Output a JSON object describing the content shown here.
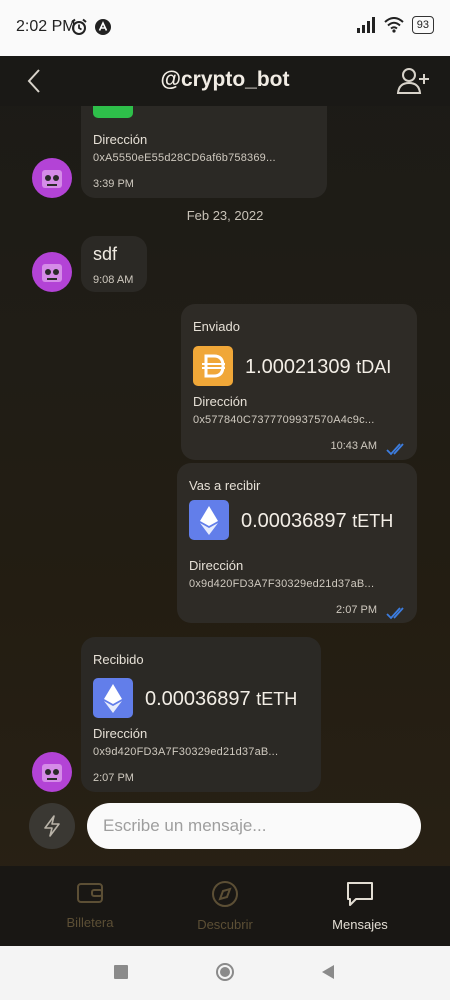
{
  "status_bar": {
    "time": "2:02 PM",
    "battery": "93",
    "icons": [
      "alarm-icon",
      "app-notification-icon",
      "signal-icon",
      "wifi-icon",
      "battery-icon"
    ]
  },
  "header": {
    "title": "@crypto_bot",
    "icons": [
      "back-arrow-icon",
      "add-user-icon"
    ]
  },
  "date_separator": "Feb 23, 2022",
  "messages": [
    {
      "side": "left",
      "type": "transaction",
      "address_label": "Dirección",
      "address": "0xA5550eE55d28CD6af6b758369...",
      "time": "3:39 PM"
    },
    {
      "side": "left",
      "type": "text",
      "text": "sdf",
      "time": "9:08 AM"
    },
    {
      "side": "right",
      "type": "transaction",
      "heading": "Enviado",
      "amount": "1.00021309",
      "token": "tDAI",
      "token_icon": "dai-icon",
      "address_label": "Dirección",
      "address": "0x577840C7377709937570A4c9c...",
      "time": "10:43 AM",
      "status_icon": "double-check-icon"
    },
    {
      "side": "right",
      "type": "transaction",
      "heading": "Vas a recibir",
      "amount": "0.00036897",
      "token": "tETH",
      "token_icon": "eth-icon",
      "address_label": "Dirección",
      "address": "0x9d420FD3A7F30329ed21d37aB...",
      "time": "2:07 PM",
      "status_icon": "double-check-icon"
    },
    {
      "side": "left",
      "type": "transaction",
      "heading": "Recibido",
      "amount": "0.00036897",
      "token": "tETH",
      "token_icon": "eth-icon",
      "address_label": "Dirección",
      "address": "0x9d420FD3A7F30329ed21d37aB...",
      "time": "2:07 PM"
    }
  ],
  "composer": {
    "placeholder": "Escribe un mensaje...",
    "value": "",
    "icon": "lightning-icon"
  },
  "bottom_nav": {
    "items": [
      {
        "label": "Billetera",
        "icon": "wallet-icon",
        "active": false
      },
      {
        "label": "Descubrir",
        "icon": "compass-icon",
        "active": false
      },
      {
        "label": "Mensajes",
        "icon": "chat-icon",
        "active": true
      }
    ]
  },
  "system_nav": [
    "recents-square-icon",
    "home-circle-icon",
    "back-triangle-icon"
  ],
  "colors": {
    "background": "#1b1a17",
    "bubble": "#2b2925",
    "avatar": "#b343d6",
    "dai": "#f0a738",
    "eth": "#627eea",
    "read_check": "#3c7de0",
    "nav_inactive": "#5c4f35",
    "nav_active": "#e2ddd3"
  }
}
